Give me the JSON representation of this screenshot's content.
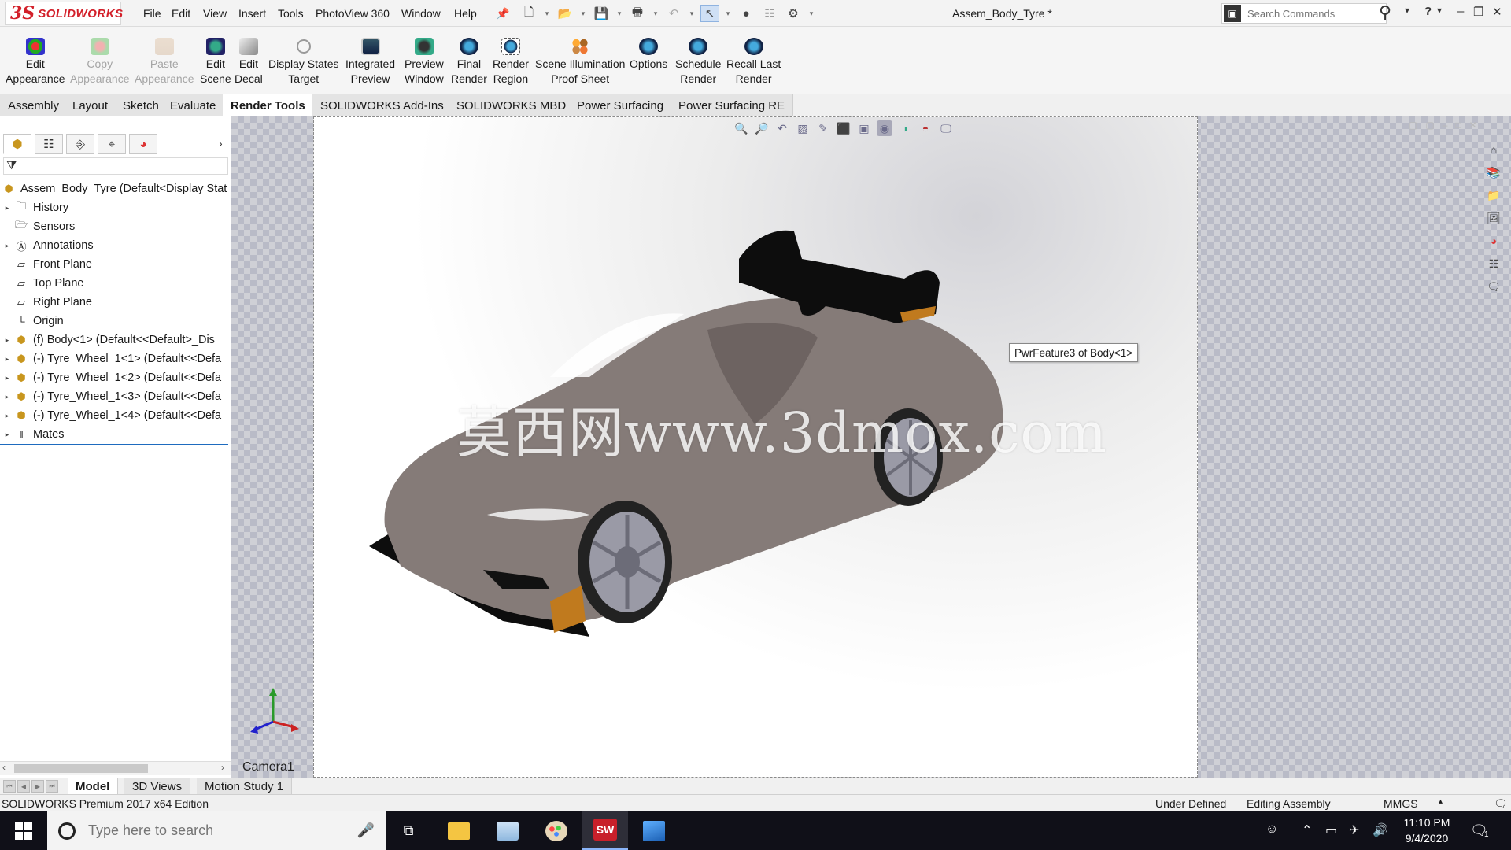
{
  "app": {
    "logo_prefix": "3S",
    "logo_name": "SOLIDWORKS",
    "menu": [
      "File",
      "Edit",
      "View",
      "Insert",
      "Tools",
      "PhotoView 360",
      "Window",
      "Help"
    ],
    "document_title": "Assem_Body_Tyre *",
    "search_placeholder": "Search Commands",
    "help_label": "?"
  },
  "ribbon": {
    "buttons": [
      {
        "line1": "Edit",
        "line2": "Appearance",
        "icon": "edit-appearance-icon",
        "enabled": true
      },
      {
        "line1": "Copy",
        "line2": "Appearance",
        "icon": "copy-appearance-icon",
        "enabled": false
      },
      {
        "line1": "Paste",
        "line2": "Appearance",
        "icon": "paste-appearance-icon",
        "enabled": false
      },
      {
        "line1": "Edit",
        "line2": "Scene",
        "icon": "edit-scene-icon",
        "enabled": true
      },
      {
        "line1": "Edit",
        "line2": "Decal",
        "icon": "edit-decal-icon",
        "enabled": true
      },
      {
        "line1": "Display States",
        "line2": "Target",
        "icon": "display-states-target-icon",
        "enabled": true
      },
      {
        "line1": "Integrated",
        "line2": "Preview",
        "icon": "integrated-preview-icon",
        "enabled": true
      },
      {
        "line1": "Preview",
        "line2": "Window",
        "icon": "preview-window-icon",
        "enabled": true
      },
      {
        "line1": "Final",
        "line2": "Render",
        "icon": "final-render-icon",
        "enabled": true
      },
      {
        "line1": "Render",
        "line2": "Region",
        "icon": "render-region-icon",
        "enabled": true
      },
      {
        "line1": "Scene Illumination",
        "line2": "Proof Sheet",
        "icon": "scene-illumination-icon",
        "enabled": true
      },
      {
        "line1": "Options",
        "line2": "",
        "icon": "options-icon",
        "enabled": true
      },
      {
        "line1": "Schedule",
        "line2": "Render",
        "icon": "schedule-render-icon",
        "enabled": true
      },
      {
        "line1": "Recall Last",
        "line2": "Render",
        "icon": "recall-last-render-icon",
        "enabled": true
      }
    ]
  },
  "tabs": [
    "Assembly",
    "Layout",
    "Sketch",
    "Evaluate",
    "Render Tools",
    "SOLIDWORKS Add-Ins",
    "SOLIDWORKS MBD",
    "Power Surfacing",
    "Power Surfacing RE"
  ],
  "active_tab": "Render Tools",
  "tree": {
    "root": "Assem_Body_Tyre  (Default<Display Stat",
    "nodes": [
      {
        "label": "History",
        "icon": "history-icon",
        "expandable": true
      },
      {
        "label": "Sensors",
        "icon": "sensors-icon",
        "expandable": false
      },
      {
        "label": "Annotations",
        "icon": "annotations-icon",
        "expandable": true
      },
      {
        "label": "Front Plane",
        "icon": "plane-icon",
        "expandable": false
      },
      {
        "label": "Top Plane",
        "icon": "plane-icon",
        "expandable": false
      },
      {
        "label": "Right Plane",
        "icon": "plane-icon",
        "expandable": false
      },
      {
        "label": "Origin",
        "icon": "origin-icon",
        "expandable": false
      },
      {
        "label": "(f) Body<1> (Default<<Default>_Dis",
        "icon": "part-icon",
        "expandable": true
      },
      {
        "label": "(-) Tyre_Wheel_1<1> (Default<<Defa",
        "icon": "part-icon",
        "expandable": true
      },
      {
        "label": "(-) Tyre_Wheel_1<2> (Default<<Defa",
        "icon": "part-icon",
        "expandable": true
      },
      {
        "label": "(-) Tyre_Wheel_1<3> (Default<<Defa",
        "icon": "part-icon",
        "expandable": true
      },
      {
        "label": "(-) Tyre_Wheel_1<4> (Default<<Defa",
        "icon": "part-icon",
        "expandable": true
      },
      {
        "label": "Mates",
        "icon": "mates-icon",
        "expandable": true
      }
    ]
  },
  "graphics": {
    "tooltip": "PwrFeature3 of Body<1>",
    "watermark": "莫西网www.3dmox.com",
    "camera_label": "Camera1",
    "car_body_color": "#857b78",
    "wing_color": "#0d0d0d",
    "accent_color": "#c07a1e"
  },
  "bottom_tabs": [
    "Model",
    "3D Views",
    "Motion Study 1"
  ],
  "active_bottom_tab": "Model",
  "status": {
    "edition": "SOLIDWORKS Premium 2017 x64 Edition",
    "state": "Under Defined",
    "mode": "Editing Assembly",
    "units": "MMGS"
  },
  "taskbar": {
    "search_placeholder": "Type here to search",
    "time": "11:10 PM",
    "date": "9/4/2020",
    "notification_count": "1",
    "apps": [
      "file-explorer-icon",
      "photos-viewer-icon",
      "paint-icon",
      "solidworks-icon",
      "photos-icon"
    ],
    "solidworks_badge": "SW"
  }
}
